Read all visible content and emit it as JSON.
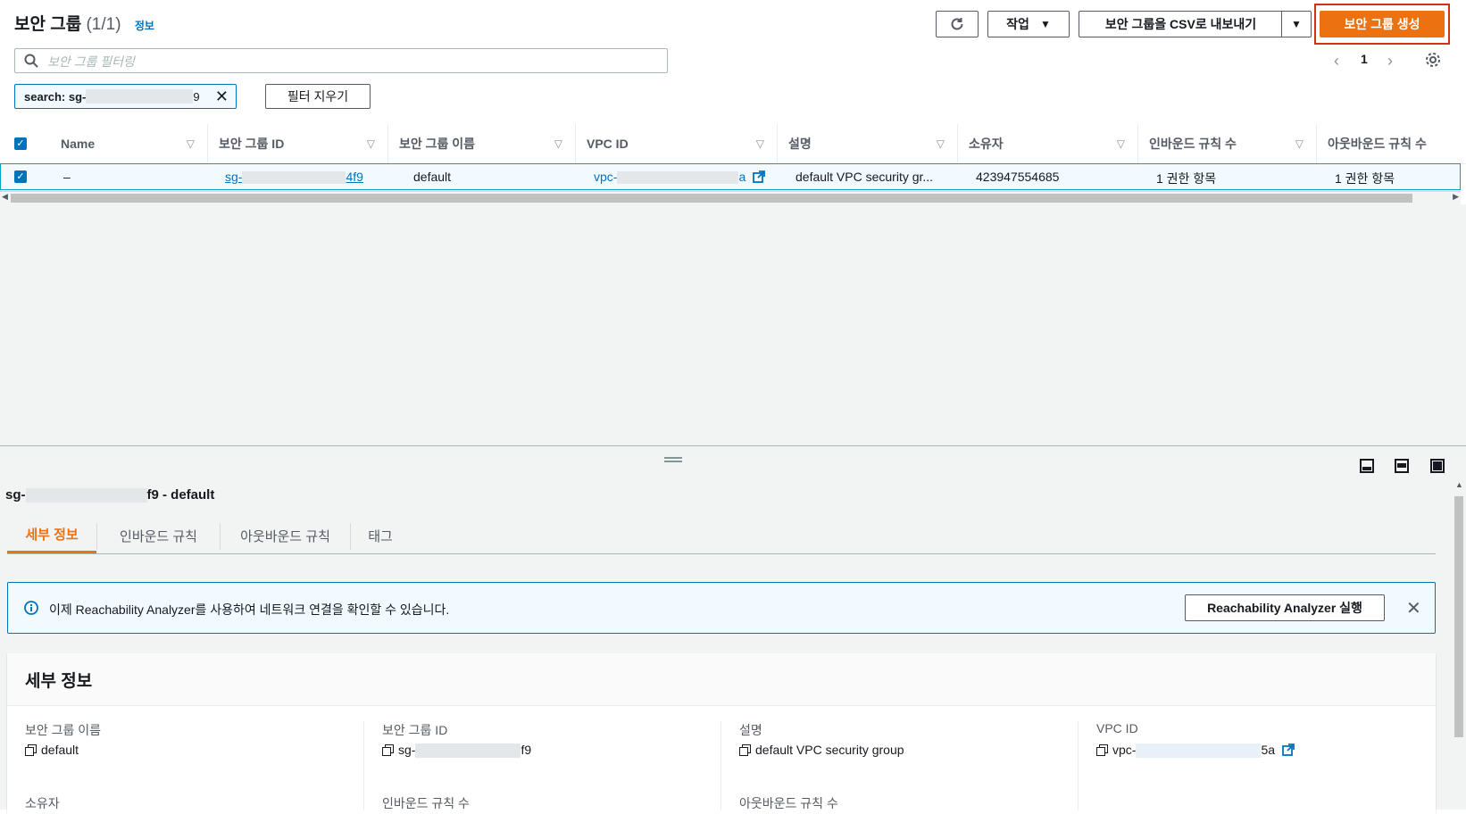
{
  "header": {
    "title": "보안 그룹",
    "count": "(1/1)",
    "info": "정보",
    "refresh_icon": "refresh-icon",
    "actions_label": "작업",
    "export_label": "보안 그룹을 CSV로 내보내기",
    "create_label": "보안 그룹 생성"
  },
  "filter": {
    "placeholder": "보안 그룹 필터링",
    "token_prefix": "search: sg-",
    "token_suffix": "9",
    "clear_label": "필터 지우기"
  },
  "pagination": {
    "page": "1"
  },
  "table": {
    "columns": [
      "Name",
      "보안 그룹 ID",
      "보안 그룹 이름",
      "VPC ID",
      "설명",
      "소유자",
      "인바운드 규칙 수",
      "아웃바운드 규칙 수"
    ],
    "row": {
      "name": "–",
      "sg_prefix": "sg-",
      "sg_suffix": "4f9",
      "group_name": "default",
      "vpc_prefix": "vpc-",
      "vpc_suffix": "a",
      "description": "default VPC security gr...",
      "owner": "423947554685",
      "inbound": "1 권한 항목",
      "outbound": "1 권한 항목"
    }
  },
  "panel": {
    "title_prefix": "sg-",
    "title_suffix": "f9 - default",
    "tabs": [
      "세부 정보",
      "인바운드 규칙",
      "아웃바운드 규칙",
      "태그"
    ],
    "alert_text": "이제 Reachability Analyzer를 사용하여 네트워크 연결을 확인할 수 있습니다.",
    "alert_button": "Reachability Analyzer 실행",
    "details_title": "세부 정보",
    "fields": {
      "group_name_label": "보안 그룹 이름",
      "group_name_value": "default",
      "group_id_label": "보안 그룹 ID",
      "group_id_prefix": "sg-",
      "group_id_suffix": "f9",
      "desc_label": "설명",
      "desc_value": "default VPC security group",
      "vpc_label": "VPC ID",
      "vpc_prefix": "vpc-",
      "vpc_suffix": "5a",
      "owner_label": "소유자",
      "inbound_label": "인바운드 규칙 수",
      "outbound_label": "아웃바운드 규칙 수"
    }
  },
  "colors": {
    "primary": "#ec7211",
    "link": "#0073bb",
    "highlight": "#d13212"
  }
}
